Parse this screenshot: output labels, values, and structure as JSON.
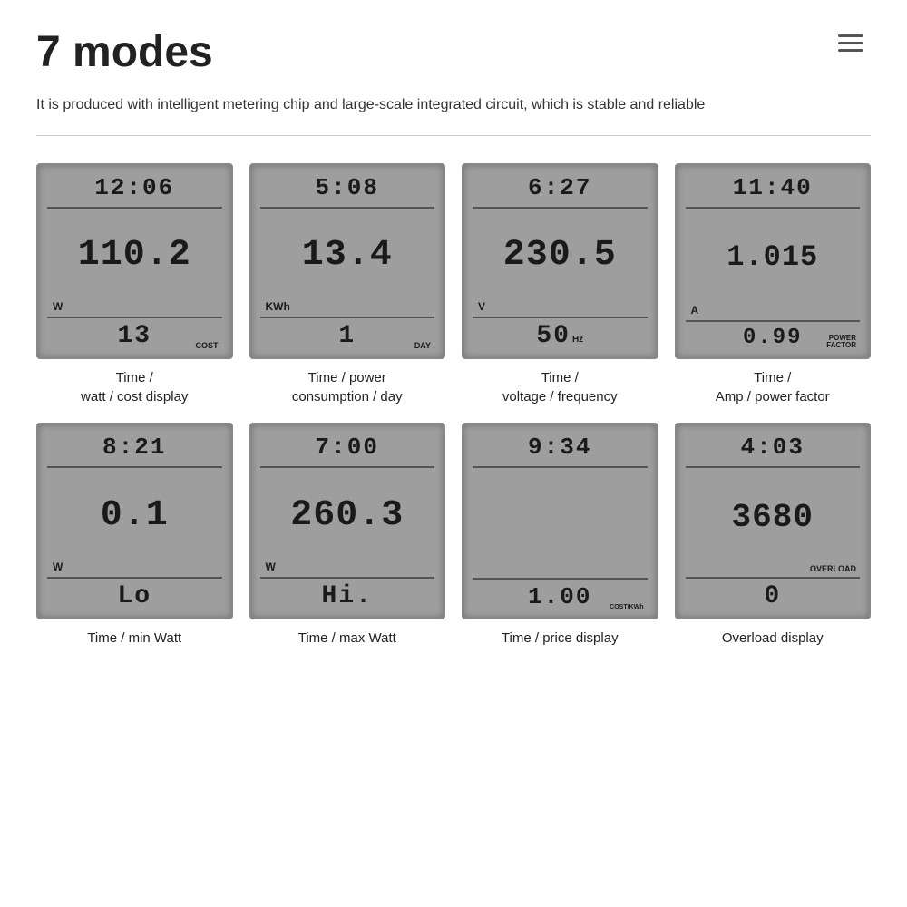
{
  "header": {
    "title": "7 modes",
    "menu_icon_label": "menu"
  },
  "description": "It is produced with intelligent metering chip and large-scale integrated circuit, which is stable and reliable",
  "modes": [
    {
      "time": "12:06",
      "main_value": "110.2",
      "unit": "W",
      "bottom_value": "13",
      "bottom_label": "COST",
      "label": "Time /\nwatt / cost display"
    },
    {
      "time": "5:08",
      "main_value": "13.4",
      "unit": "KWh",
      "bottom_value": "1",
      "bottom_label": "DAY",
      "label": "Time / power\nconsumption / day"
    },
    {
      "time": "6:27",
      "main_value": "230.5",
      "unit": "V",
      "bottom_value": "50",
      "bottom_label": "Hz",
      "label": "Time /\nvoltage / frequency"
    },
    {
      "time": "11:40",
      "main_value": "1.015",
      "unit": "A",
      "bottom_value": "0.99",
      "bottom_label": "POWER\nFACTOR",
      "label": "Time /\nAmp / power factor"
    },
    {
      "time": "8:21",
      "main_value": "0.1",
      "unit": "W",
      "bottom_value": "Lo",
      "bottom_label": "",
      "label": "Time / min Watt"
    },
    {
      "time": "7:00",
      "main_value": "260.3",
      "unit": "W",
      "bottom_value": "Hi.",
      "bottom_label": "",
      "label": "Time / max Watt"
    },
    {
      "time": "9:34",
      "main_value": "",
      "unit": "",
      "bottom_value": "1.00",
      "bottom_label": "COST/KWh",
      "label": "Time / price display"
    },
    {
      "time": "4:03",
      "main_value": "3680",
      "unit": "",
      "bottom_value": "0",
      "bottom_label": "OVERLOAD",
      "label": "Overload display"
    }
  ]
}
